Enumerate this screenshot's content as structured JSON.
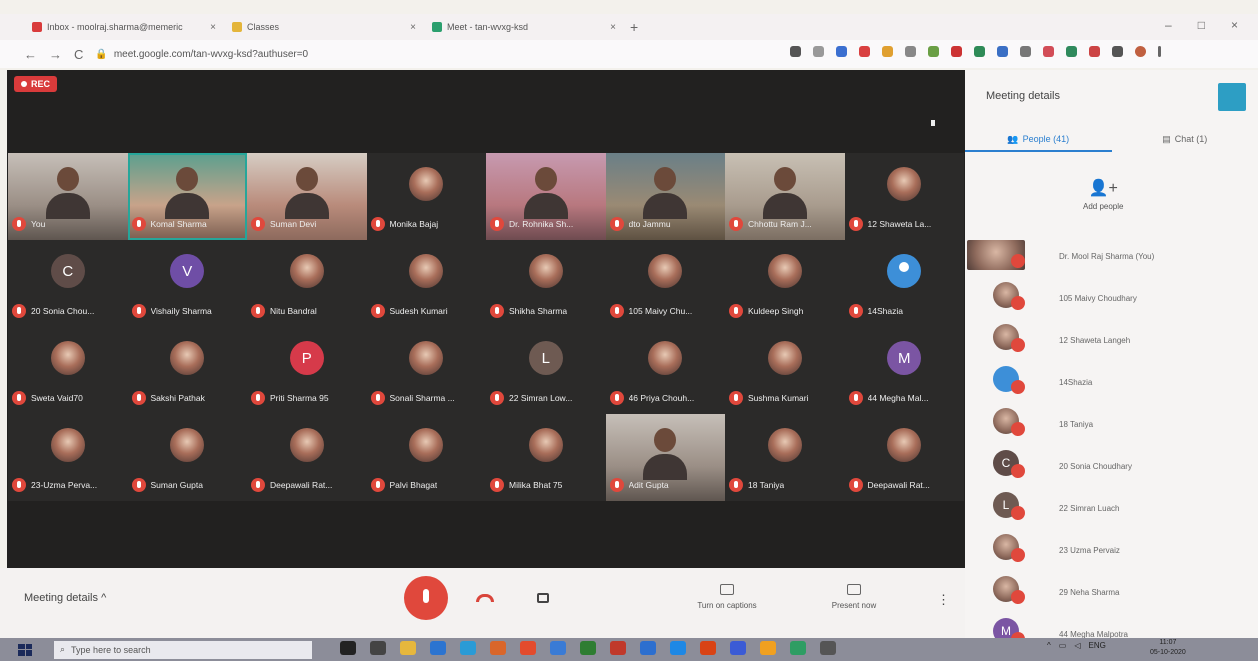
{
  "browser": {
    "tabs": [
      {
        "title": "Inbox - moolraj.sharma@memeric",
        "favicon_color": "#d93b3b"
      },
      {
        "title": "Classes",
        "favicon_color": "#e4b53a"
      },
      {
        "title": "Meet - tan-wvxg-ksd",
        "favicon_color": "#2b9f6e"
      }
    ],
    "url": "meet.google.com/tan-wvxg-ksd?authuser=0",
    "window_controls": [
      "–",
      "□",
      "×"
    ],
    "nav": {
      "back": "←",
      "forward": "→",
      "reload": "C"
    },
    "tab_close": "×",
    "tab_add": "+"
  },
  "meeting": {
    "rec_label": "REC",
    "tiles": [
      {
        "name": "You",
        "kind": "video",
        "style": "v6"
      },
      {
        "name": "Komal Sharma",
        "kind": "video",
        "style": "v2",
        "active": true
      },
      {
        "name": "Suman Devi",
        "kind": "video",
        "style": "v3"
      },
      {
        "name": "Monika Bajaj",
        "kind": "photo"
      },
      {
        "name": "Dr. Rohnika Sh...",
        "kind": "video",
        "style": "v4"
      },
      {
        "name": "dto Jammu",
        "kind": "video",
        "style": "v5"
      },
      {
        "name": "Chhottu Ram J...",
        "kind": "video",
        "style": "v7"
      },
      {
        "name": "12 Shaweta La...",
        "kind": "photo"
      },
      {
        "name": "20 Sonia Chou...",
        "kind": "letter",
        "letter": "C",
        "cls": "letter-c"
      },
      {
        "name": "Vishaily Sharma",
        "kind": "letter",
        "letter": "V",
        "cls": "letter-v"
      },
      {
        "name": "Nitu Bandral",
        "kind": "photo"
      },
      {
        "name": "Sudesh Kumari",
        "kind": "photo"
      },
      {
        "name": "Shikha Sharma",
        "kind": "photo"
      },
      {
        "name": "105 Maivy Chu...",
        "kind": "photo"
      },
      {
        "name": "Kuldeep Singh",
        "kind": "photo"
      },
      {
        "name": "14Shazia",
        "kind": "default"
      },
      {
        "name": "Sweta Vaid70",
        "kind": "photo"
      },
      {
        "name": "Sakshi Pathak",
        "kind": "photo"
      },
      {
        "name": "Priti Sharma 95",
        "kind": "letter",
        "letter": "P",
        "cls": "letter-p"
      },
      {
        "name": "Sonali Sharma ...",
        "kind": "photo"
      },
      {
        "name": "22 Simran Low...",
        "kind": "letter",
        "letter": "L",
        "cls": "letter-l"
      },
      {
        "name": "46 Priya Chouh...",
        "kind": "photo"
      },
      {
        "name": "Sushma Kumari",
        "kind": "photo"
      },
      {
        "name": "44 Megha Mal...",
        "kind": "letter",
        "letter": "M",
        "cls": "letter-m"
      },
      {
        "name": "23-Uzma Perva...",
        "kind": "photo"
      },
      {
        "name": "Suman Gupta",
        "kind": "photo"
      },
      {
        "name": "Deepawali Rat...",
        "kind": "photo"
      },
      {
        "name": "Palvi Bhagat",
        "kind": "photo"
      },
      {
        "name": "Milika Bhat 75",
        "kind": "photo"
      },
      {
        "name": "Adit Gupta",
        "kind": "video",
        "style": "v6"
      },
      {
        "name": "18 Taniya",
        "kind": "photo"
      },
      {
        "name": "Deepawali Rat...",
        "kind": "photo"
      }
    ]
  },
  "panel": {
    "title": "Meeting details",
    "tab_people": "People (41)",
    "tab_chat": "Chat (1)",
    "add_people": "Add people",
    "people": [
      {
        "name": "Dr. Mool Raj Sharma (You)",
        "self": true
      },
      {
        "name": "105 Maivy Choudhary"
      },
      {
        "name": "12 Shaweta Langeh"
      },
      {
        "name": "14Shazia",
        "letter": "",
        "cls": "d"
      },
      {
        "name": "18 Taniya"
      },
      {
        "name": "20 Sonia Choudhary",
        "letter": "C",
        "cls": "c"
      },
      {
        "name": "22 Simran Luach",
        "letter": "L",
        "cls": "l"
      },
      {
        "name": "23 Uzma Pervaiz"
      },
      {
        "name": "29 Neha Sharma"
      },
      {
        "name": "44 Megha Malpotra",
        "letter": "M",
        "cls": "m"
      }
    ]
  },
  "controls": {
    "meeting_details": "Meeting details",
    "chevron": "^",
    "captions": "Turn on captions",
    "present": "Present now",
    "more": "⋮"
  },
  "taskbar": {
    "search_placeholder": "Type here to search",
    "tray_lang": "ENG",
    "time": "11:07",
    "date": "05-10-2020",
    "app_colors": [
      "#222",
      "#444",
      "#e6b73d",
      "#2c74d0",
      "#2a9bd6",
      "#d9662a",
      "#e34b2d",
      "#3a7bd5",
      "#2e7d32",
      "#c0392b",
      "#2d6fcf",
      "#1e88e5",
      "#d84315",
      "#3b5bd5",
      "#f0a020",
      "#2e9d63",
      "#555"
    ]
  }
}
